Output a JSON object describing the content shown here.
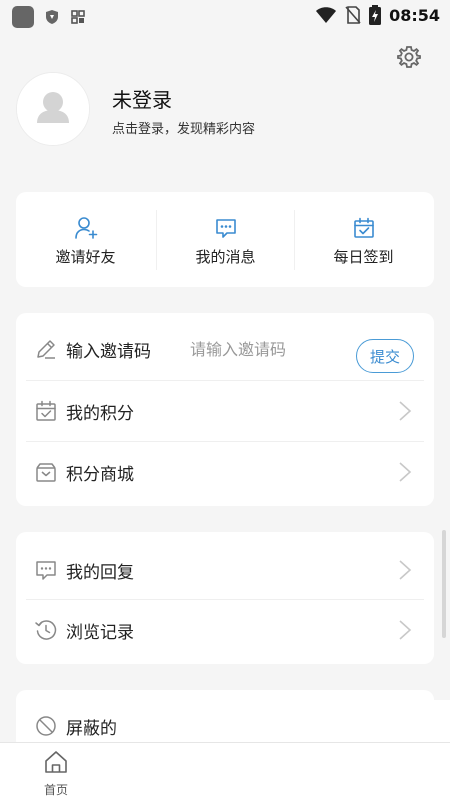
{
  "status_bar": {
    "time": "08:54"
  },
  "profile": {
    "name": "未登录",
    "subtitle": "点击登录，发现精彩内容"
  },
  "quick_actions": [
    {
      "label": "邀请好友",
      "icon": "add-user-icon"
    },
    {
      "label": "我的消息",
      "icon": "message-icon"
    },
    {
      "label": "每日签到",
      "icon": "calendar-check-icon"
    }
  ],
  "invite": {
    "label": "输入邀请码",
    "placeholder": "请输入邀请码",
    "value": "",
    "submit_label": "提交"
  },
  "menu_points": [
    {
      "label": "我的积分",
      "icon": "points-calendar-icon"
    },
    {
      "label": "积分商城",
      "icon": "gift-box-icon"
    }
  ],
  "menu_activity": [
    {
      "label": "我的回复",
      "icon": "reply-icon"
    },
    {
      "label": "浏览记录",
      "icon": "history-icon"
    }
  ],
  "menu_more": [
    {
      "label": "屏蔽的",
      "icon": "block-icon"
    }
  ],
  "tab_bar": [
    {
      "label": "首页",
      "icon": "home-icon"
    }
  ],
  "colors": {
    "accent": "#3a8bd0",
    "background": "#f5f5f5",
    "card": "#ffffff"
  }
}
